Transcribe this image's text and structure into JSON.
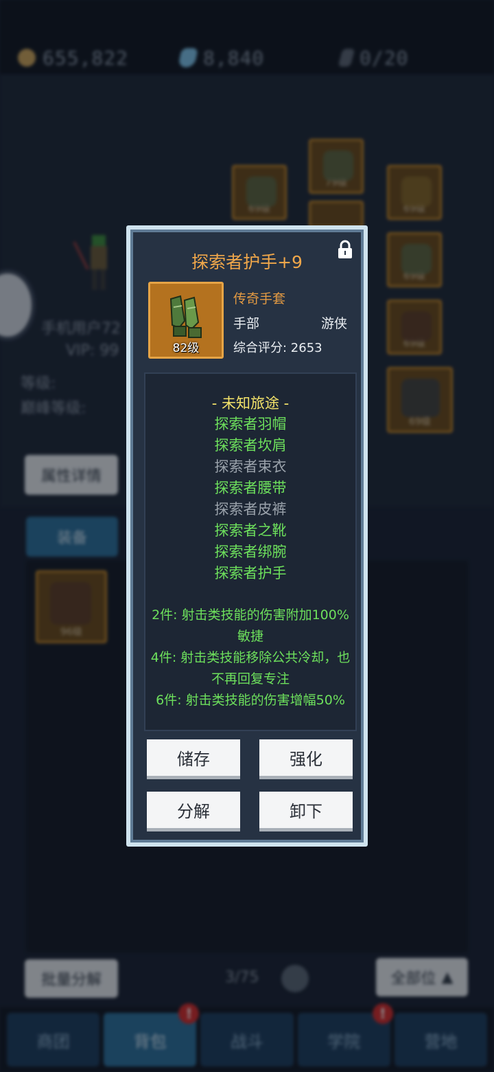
{
  "resources": {
    "gold": "655,822",
    "gems": "8,840",
    "tickets": "0/20"
  },
  "background": {
    "player_name": "手机用户72",
    "vip": "VIP: 99",
    "level_label": "等级:",
    "peak_level_label": "巅峰等级:",
    "attr_button": "属性详情",
    "equip_tab": "装备",
    "slot_levels": [
      "69级",
      "79级",
      "69级",
      "69级",
      "69级",
      "69级",
      "96级"
    ],
    "batch_button": "批量分解",
    "page": "3/75",
    "all_parts_button": "全部位"
  },
  "bottom_nav": {
    "items": [
      {
        "label": "商团",
        "badge": ""
      },
      {
        "label": "背包",
        "badge": "!"
      },
      {
        "label": "战斗",
        "badge": ""
      },
      {
        "label": "学院",
        "badge": "!"
      },
      {
        "label": "营地",
        "badge": ""
      }
    ]
  },
  "item": {
    "name": "探索者护手+9",
    "level": "82级",
    "quality": "传奇手套",
    "part": "手部",
    "class": "游侠",
    "score": "综合评分: 2653",
    "icon": "green-glove-icon",
    "locked": true
  },
  "set": {
    "name": "- 未知旅途 -",
    "pieces": [
      {
        "name": "探索者羽帽",
        "owned": true
      },
      {
        "name": "探索者坎肩",
        "owned": true
      },
      {
        "name": "探索者束衣",
        "owned": false
      },
      {
        "name": "探索者腰带",
        "owned": true
      },
      {
        "name": "探索者皮裤",
        "owned": false
      },
      {
        "name": "探索者之靴",
        "owned": true
      },
      {
        "name": "探索者绑腕",
        "owned": true
      },
      {
        "name": "探索者护手",
        "owned": true
      }
    ],
    "bonuses": [
      "2件: 射击类技能的伤害附加100%敏捷",
      "4件: 射击类技能移除公共冷却，也不再回复专注",
      "6件: 射击类技能的伤害增幅50%"
    ]
  },
  "actions": {
    "store": "储存",
    "enhance": "强化",
    "dismantle": "分解",
    "unequip": "卸下"
  },
  "colors": {
    "legendary": "#e39a43",
    "set_active": "#6de05c",
    "set_inactive": "#9aa2ab",
    "set_title": "#f4e36a"
  }
}
